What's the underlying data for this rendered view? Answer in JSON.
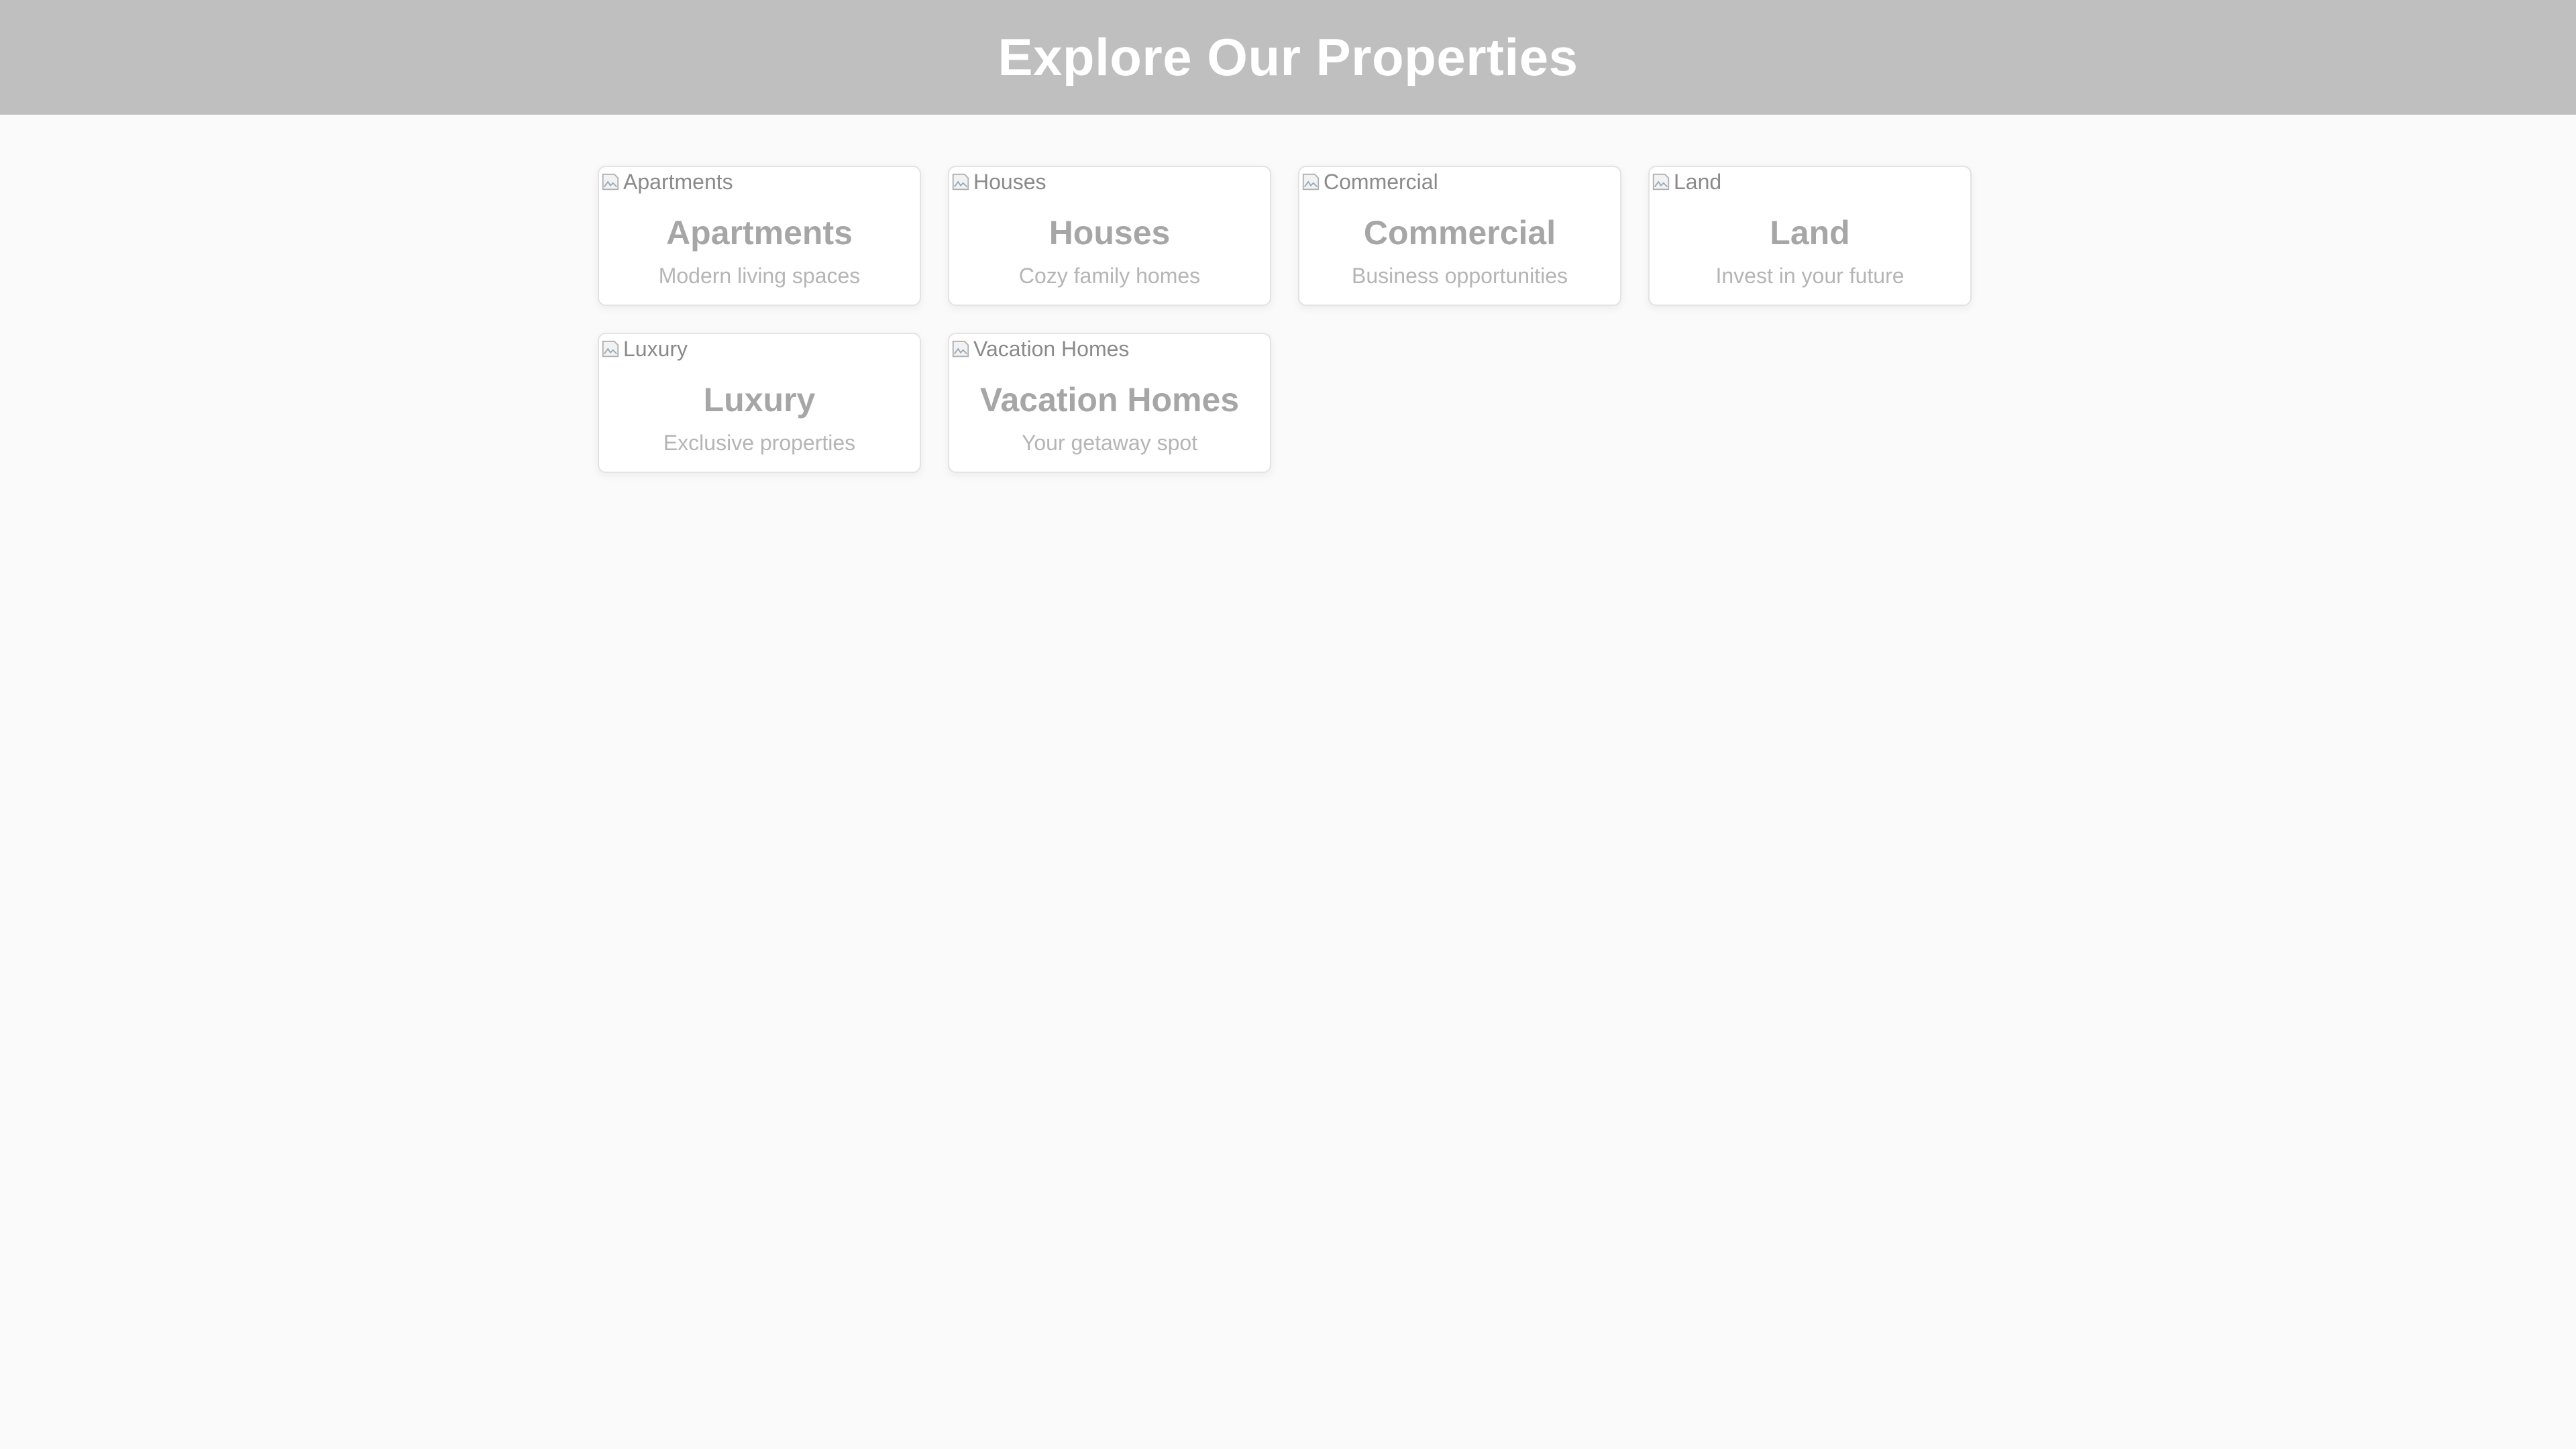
{
  "header": {
    "title": "Explore Our Properties"
  },
  "properties": [
    {
      "alt": "Apartments",
      "title": "Apartments",
      "description": "Modern living spaces",
      "icon": "broken-image-icon"
    },
    {
      "alt": "Houses",
      "title": "Houses",
      "description": "Cozy family homes",
      "icon": "broken-image-icon"
    },
    {
      "alt": "Commercial",
      "title": "Commercial",
      "description": "Business opportunities",
      "icon": "broken-image-icon"
    },
    {
      "alt": "Land",
      "title": "Land",
      "description": "Invest in your future",
      "icon": "broken-image-icon"
    },
    {
      "alt": "Luxury",
      "title": "Luxury",
      "description": "Exclusive properties",
      "icon": "broken-image-icon"
    },
    {
      "alt": "Vacation Homes",
      "title": "Vacation Homes",
      "description": "Your getaway spot",
      "icon": "broken-image-icon"
    }
  ],
  "colors": {
    "header_bg": "#bfbfbf",
    "page_bg": "#fafafa",
    "card_bg": "#ffffff",
    "title_text": "#a6a6a6",
    "desc_text": "#b5b5b5"
  }
}
